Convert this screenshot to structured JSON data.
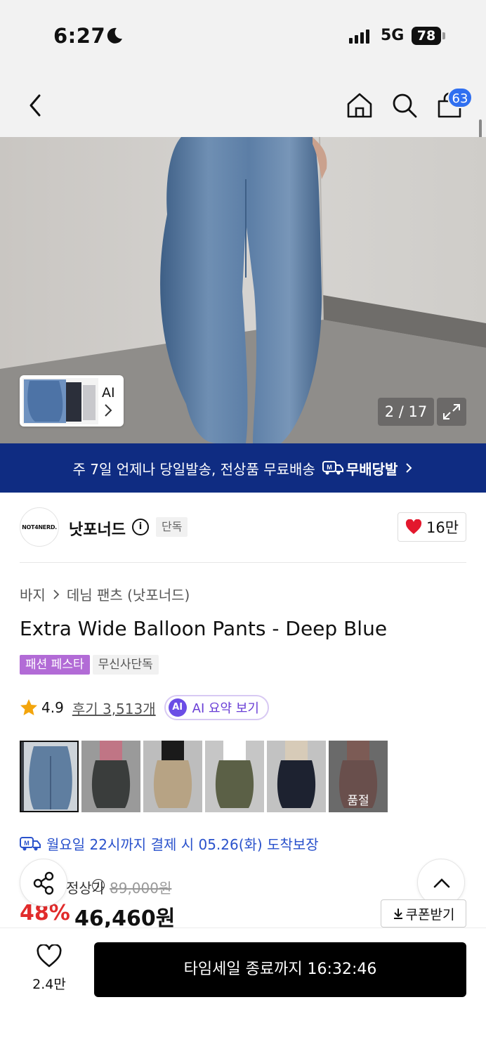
{
  "status_bar": {
    "time": "6:27",
    "network": "5G",
    "battery": "78"
  },
  "header": {
    "cart_count": "63"
  },
  "gallery": {
    "ai_label": "AI",
    "counter": "2 / 17"
  },
  "banner": {
    "text": "주 7일 언제나 당일발송, 전상품 무료배송",
    "service_name": "무배당발"
  },
  "brand": {
    "logo_text": "NOT4NERD.",
    "name": "낫포너드",
    "exclusive_tag": "단독",
    "likes": "16만"
  },
  "breadcrumb": {
    "category": "바지",
    "subcategory": "데님 팬츠 (낫포너드)"
  },
  "product": {
    "title": "Extra Wide Balloon Pants - Deep Blue",
    "badges": {
      "festa": "패션 페스타",
      "exclusive": "무신사단독"
    },
    "rating": "4.9",
    "review_text": "후기 3,513개",
    "ai_summary": "AI 요약 보기",
    "ai_dot": "AI"
  },
  "colors": {
    "swatches": [
      {
        "color": "#5f7ea0",
        "selected": true
      },
      {
        "color": "#3a3d3c"
      },
      {
        "color": "#b7a384"
      },
      {
        "color": "#5b6046"
      },
      {
        "color": "#1d2230"
      },
      {
        "color": "#8c6a66",
        "soldout": true
      }
    ],
    "soldout_label": "품절"
  },
  "delivery": {
    "text": "월요일 22시까지 결제 시 05.26(화) 도착보장"
  },
  "price": {
    "original_label": "정상가",
    "original": "89,000원",
    "discount": "48%",
    "final": "46,460원",
    "coupon": "쿠폰받기"
  },
  "bottom": {
    "wish_count": "2.4만",
    "buy_label": "타임세일 종료까지 16:32:46"
  },
  "colors_theme": {
    "banner": "#0f2c82",
    "discount": "#e12b2b",
    "delivery": "#2a52cc",
    "badge": "#b26bd6",
    "cart_badge": "#2f6ff0"
  }
}
